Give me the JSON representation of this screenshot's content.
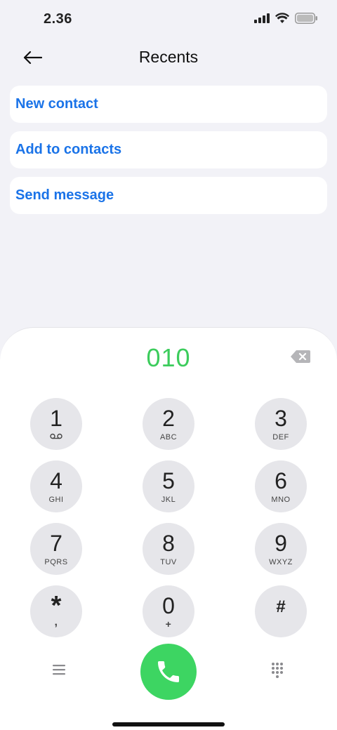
{
  "status_bar": {
    "time": "2.36",
    "icons": [
      "signal-icon",
      "wifi-icon",
      "battery-icon"
    ]
  },
  "header": {
    "title": "Recents",
    "back_icon": "arrow-left-icon"
  },
  "actions": [
    {
      "label": "New contact"
    },
    {
      "label": "Add to contacts"
    },
    {
      "label": "Send message"
    }
  ],
  "dialer": {
    "number": "010",
    "backspace_icon": "backspace-icon",
    "keys": [
      {
        "digit": "1",
        "sub": "",
        "sub_icon": "voicemail-icon"
      },
      {
        "digit": "2",
        "sub": "ABC"
      },
      {
        "digit": "3",
        "sub": "DEF"
      },
      {
        "digit": "4",
        "sub": "GHI"
      },
      {
        "digit": "5",
        "sub": "JKL"
      },
      {
        "digit": "6",
        "sub": "MNO"
      },
      {
        "digit": "7",
        "sub": "PQRS"
      },
      {
        "digit": "8",
        "sub": "TUV"
      },
      {
        "digit": "9",
        "sub": "WXYZ"
      },
      {
        "digit": "*",
        "sub": ","
      },
      {
        "digit": "0",
        "sub": "+"
      },
      {
        "digit": "#",
        "sub": ""
      }
    ],
    "menu_icon": "menu-icon",
    "call_icon": "phone-icon",
    "keypad_icon": "dialpad-icon"
  },
  "colors": {
    "accent_blue": "#1a73e8",
    "dial_green": "#3ccc5c",
    "call_green": "#3dd562",
    "key_gray": "#e6e6ea",
    "background": "#f2f2f7"
  }
}
